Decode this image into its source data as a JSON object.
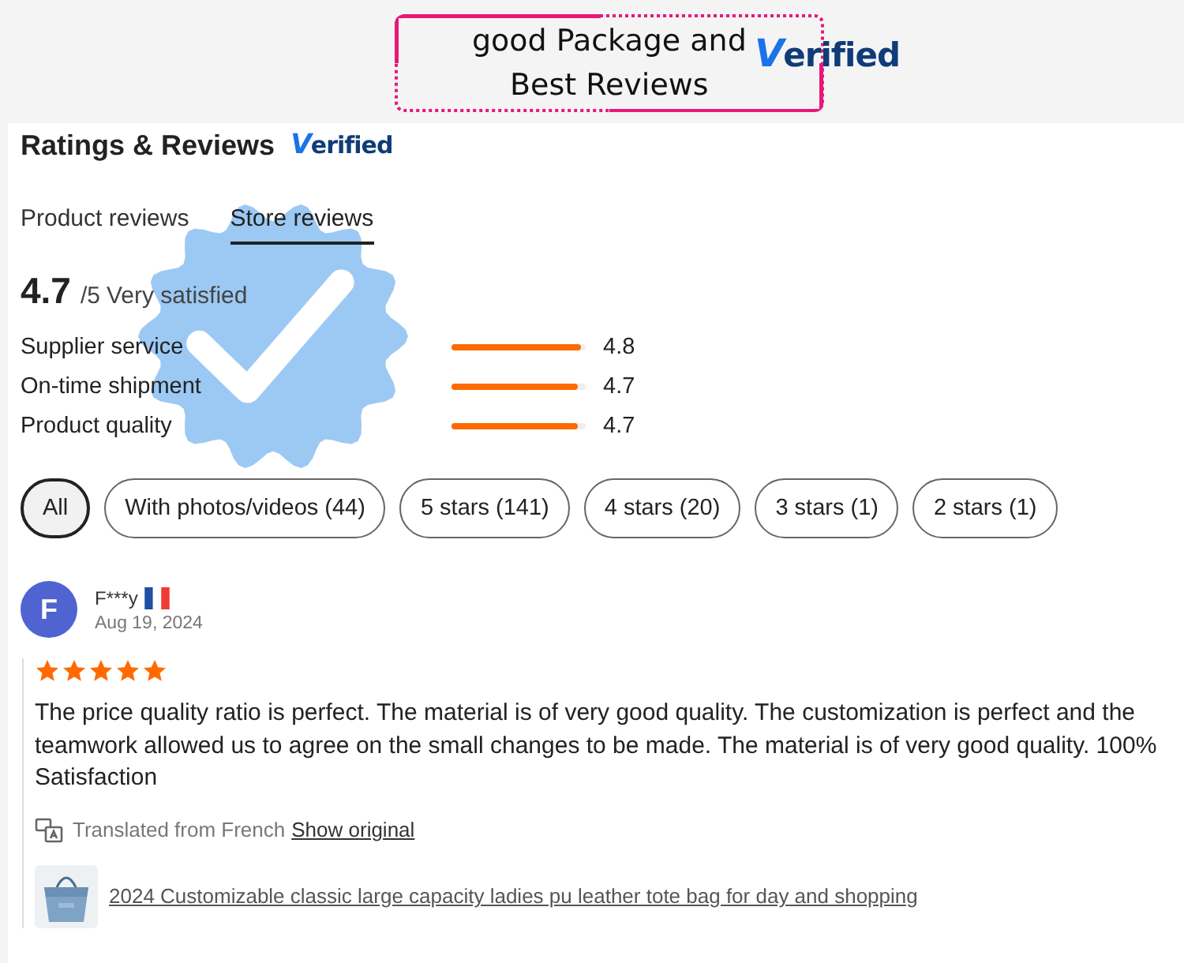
{
  "banner": {
    "title": "good Package and\nBest Reviews",
    "logo": "Verified"
  },
  "section": {
    "title": "Ratings & Reviews",
    "logo": "Verified"
  },
  "tabs": [
    {
      "label": "Product reviews",
      "selected": false
    },
    {
      "label": "Store reviews",
      "selected": true
    }
  ],
  "summary": {
    "score": "4.7",
    "scale": "/5",
    "verdict": "Very satisfied"
  },
  "metrics": [
    {
      "label": "Supplier service",
      "level": 0.96,
      "reading": "4.8"
    },
    {
      "label": "On-time shipment",
      "level": 0.94,
      "reading": "4.7"
    },
    {
      "label": "Product quality",
      "level": 0.94,
      "reading": "4.7"
    }
  ],
  "filters": [
    {
      "label": "All",
      "selected": true
    },
    {
      "label": "With photos/videos (44)",
      "selected": false
    },
    {
      "label": "5 stars (141)",
      "selected": false
    },
    {
      "label": "4 stars (20)",
      "selected": false
    },
    {
      "label": "3 stars (1)",
      "selected": false
    },
    {
      "label": "2 stars (1)",
      "selected": false
    }
  ],
  "review": {
    "avatar": "F",
    "author": "F***y",
    "date": "Aug 19, 2024",
    "stars": 5,
    "text": "The price quality ratio is perfect. The material is of very good quality. The customization is perfect and the teamwork allowed us to agree on the small changes to be made. The material is of very good quality. 100% Satisfaction",
    "translation": "Translated from French",
    "show_original": "Show original",
    "product": {
      "kind": "picture",
      "title": "2024 Customizable classic large capacity ladies pu leather tote bag for day and shopping"
    }
  }
}
